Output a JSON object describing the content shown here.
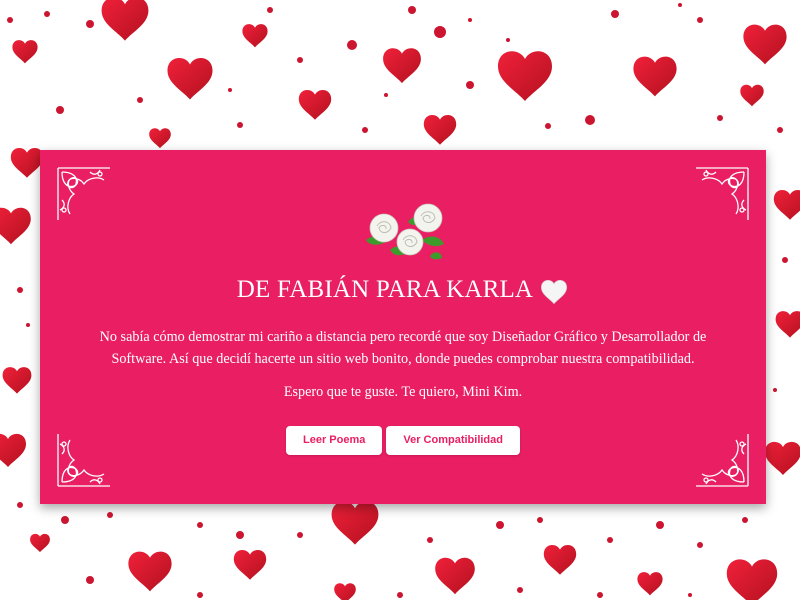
{
  "card": {
    "title": "DE FABIÁN PARA KARLA",
    "title_emoji": "white-heart-icon",
    "message": "No sabía cómo demostrar mi cariño a distancia pero recordé que soy Diseñador Gráfico y Desarrollador de Software. Así que decidí hacerte un sitio web bonito, donde puedes comprobar nuestra compatibilidad.",
    "message2": "Espero que te guste. Te quiero, Mini Kim.",
    "buttons": {
      "poem": "Leer Poema",
      "compat": "Ver Compatibilidad"
    }
  },
  "colors": {
    "card_bg": "#e91e63",
    "heart_red": "#d3172e",
    "text": "#ffffff"
  }
}
